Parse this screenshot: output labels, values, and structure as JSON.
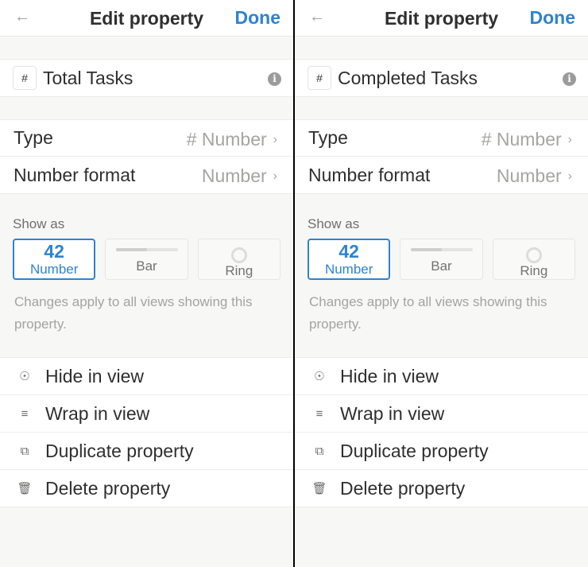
{
  "panels": [
    {
      "header": {
        "title": "Edit property",
        "done": "Done"
      },
      "property": {
        "type_glyph": "#",
        "name": "Total Tasks"
      },
      "type": {
        "label": "Type",
        "value": "# Number"
      },
      "number_format": {
        "label": "Number format",
        "value": "Number"
      },
      "show_as": {
        "label": "Show as",
        "options": [
          {
            "preview": "42",
            "label": "Number",
            "selected": true
          },
          {
            "label": "Bar",
            "fill": 0.5
          },
          {
            "label": "Ring"
          }
        ],
        "help": "Changes apply to all views showing this property."
      },
      "menu": [
        {
          "icon": "eye-off-icon",
          "label": "Hide in view"
        },
        {
          "icon": "wrap-icon",
          "label": "Wrap in view"
        },
        {
          "icon": "duplicate-icon",
          "label": "Duplicate property"
        },
        {
          "icon": "trash-icon",
          "label": "Delete property"
        }
      ]
    },
    {
      "header": {
        "title": "Edit property",
        "done": "Done"
      },
      "property": {
        "type_glyph": "#",
        "name": "Completed Tasks"
      },
      "type": {
        "label": "Type",
        "value": "# Number"
      },
      "number_format": {
        "label": "Number format",
        "value": "Number"
      },
      "show_as": {
        "label": "Show as",
        "options": [
          {
            "preview": "42",
            "label": "Number",
            "selected": true
          },
          {
            "label": "Bar",
            "fill": 0.5
          },
          {
            "label": "Ring"
          }
        ],
        "help": "Changes apply to all views showing this property."
      },
      "menu": [
        {
          "icon": "eye-off-icon",
          "label": "Hide in view"
        },
        {
          "icon": "wrap-icon",
          "label": "Wrap in view"
        },
        {
          "icon": "duplicate-icon",
          "label": "Duplicate property"
        },
        {
          "icon": "trash-icon",
          "label": "Delete property"
        }
      ]
    }
  ],
  "colors": {
    "accent": "#2e83d0",
    "background": "#f7f7f5"
  }
}
